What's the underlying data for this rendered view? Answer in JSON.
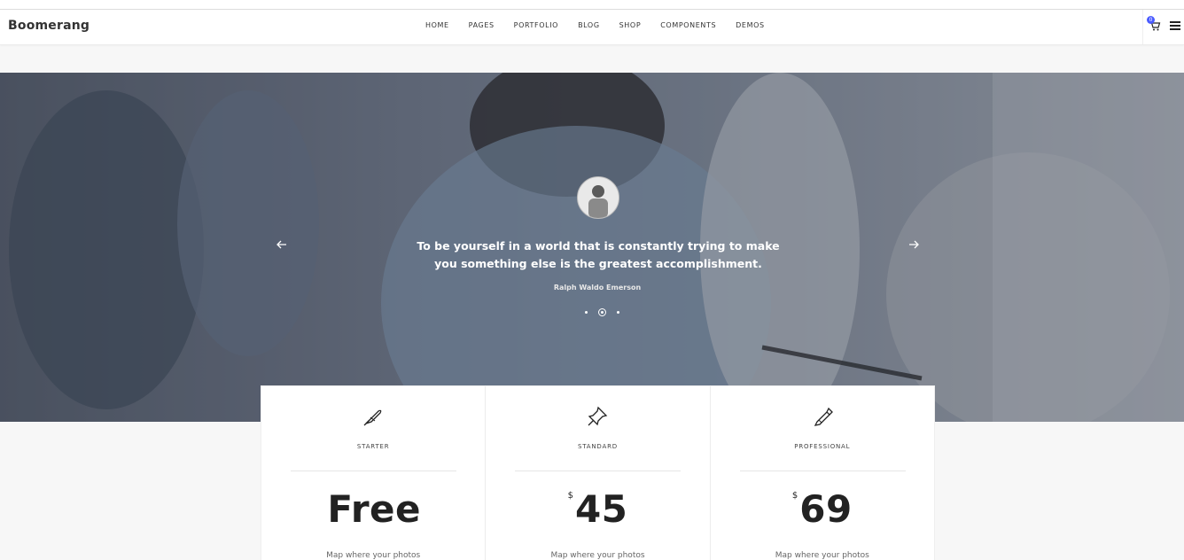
{
  "navbar": {
    "brand": "Boomerang",
    "links": [
      "HOME",
      "PAGES",
      "PORTFOLIO",
      "BLOG",
      "SHOP",
      "COMPONENTS",
      "DEMOS"
    ],
    "cart_count": "0",
    "icons": {
      "cart": "cart-icon",
      "menu": "hamburger-menu-icon"
    }
  },
  "hero": {
    "quote": "To be yourself in a world that is constantly trying to make you something else is the greatest accomplishment.",
    "author": "Ralph Waldo Emerson",
    "slide_count": 3,
    "active_slide": 2,
    "icons": {
      "prev": "arrow-left-icon",
      "next": "arrow-right-icon"
    }
  },
  "pricing": {
    "plans": [
      {
        "name": "STARTER",
        "currency": "",
        "price": "Free",
        "desc": "Map where your photos",
        "icon": "feather-icon"
      },
      {
        "name": "STANDARD",
        "currency": "$",
        "price": "45",
        "desc": "Map where your photos",
        "icon": "pushpin-icon"
      },
      {
        "name": "PROFESSIONAL",
        "currency": "$",
        "price": "69",
        "desc": "Map where your photos",
        "icon": "pen-icon"
      }
    ]
  },
  "colors": {
    "accent": "#4a5bff",
    "text_dark": "#222222",
    "background": "#f7f7f7"
  }
}
